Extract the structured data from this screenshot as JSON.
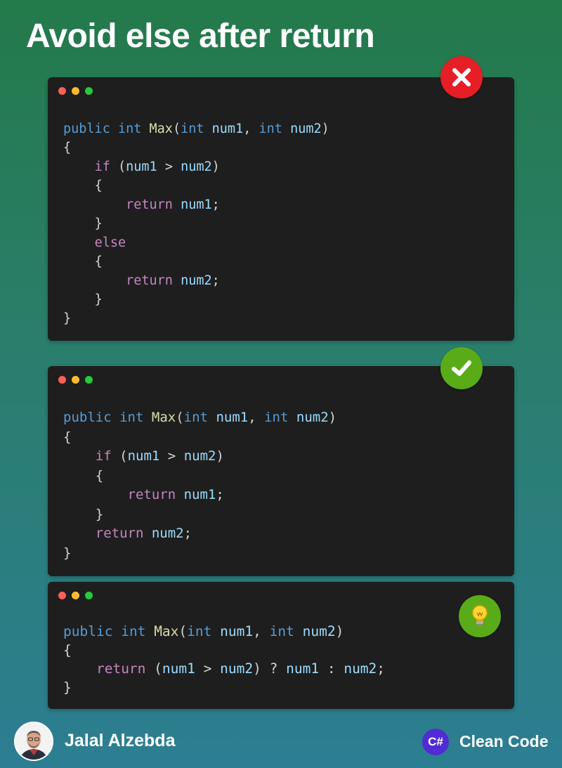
{
  "title": "Avoid else after return",
  "examples": [
    {
      "verdict": "bad",
      "badge_icon": "x-mark-icon",
      "badge_color": "#e61e26",
      "lines": [
        "public int Max(int num1, int num2)",
        "{",
        "    if (num1 > num2)",
        "    {",
        "        return num1;",
        "    }",
        "    else",
        "    {",
        "        return num2;",
        "    }",
        "}"
      ]
    },
    {
      "verdict": "good",
      "badge_icon": "checkmark-icon",
      "badge_color": "#5aab18",
      "lines": [
        "public int Max(int num1, int num2)",
        "{",
        "    if (num1 > num2)",
        "    {",
        "        return num1;",
        "    }",
        "    return num2;",
        "}"
      ]
    },
    {
      "verdict": "tip",
      "badge_icon": "lightbulb-icon",
      "badge_color": "#5aab18",
      "lines": [
        "public int Max(int num1, int num2)",
        "{",
        "    return (num1 > num2) ? num1 : num2;",
        "}"
      ]
    }
  ],
  "footer": {
    "author": "Jalal Alzebda",
    "logo_text": "C#",
    "brand": "Clean Code"
  },
  "colors": {
    "keyword": "#569cd6",
    "function": "#dcdcaa",
    "control": "#c586c0",
    "identifier": "#9cdcfe",
    "punctuation": "#d4d4d4",
    "editor_bg": "#1e1e1e"
  }
}
